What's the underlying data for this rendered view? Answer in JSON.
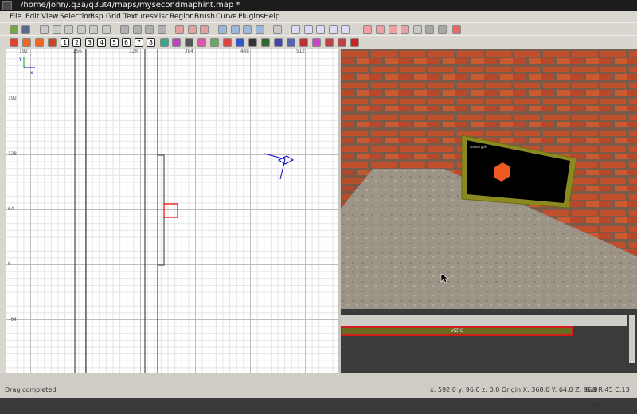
{
  "window": {
    "title": "/home/john/.q3a/q3ut4/maps/mysecondmaphint.map *"
  },
  "menu": [
    "File",
    "Edit",
    "View",
    "Selection",
    "Bsp",
    "Grid",
    "Textures",
    "Misc",
    "Region",
    "Brush",
    "Curve",
    "Plugins",
    "Help"
  ],
  "toolbar": {
    "numbers": [
      "1",
      "2",
      "3",
      "4",
      "5",
      "6",
      "7",
      "8"
    ]
  },
  "grid": {
    "top_labels": [
      "192",
      "256",
      "320",
      "384",
      "448",
      "512"
    ],
    "left_labels": [
      "192",
      "128",
      "64",
      "0",
      "-64"
    ],
    "axis_y": "y",
    "axis_x": "x"
  },
  "texture_browser": {
    "texture_label": "VIZIO"
  },
  "camera": {
    "sign_text": "unreal grill"
  },
  "status": {
    "message": "Drag completed.",
    "coords": "x: 592.0  y: 96.0  z: 0.0 Origin X: 368.0  Y: 64.0  Z: 96.0",
    "grid_info": "G:8 R:45 C:13 L:MR"
  },
  "colors": {
    "accent": "#d21b1b",
    "selection": "#0000cc"
  }
}
